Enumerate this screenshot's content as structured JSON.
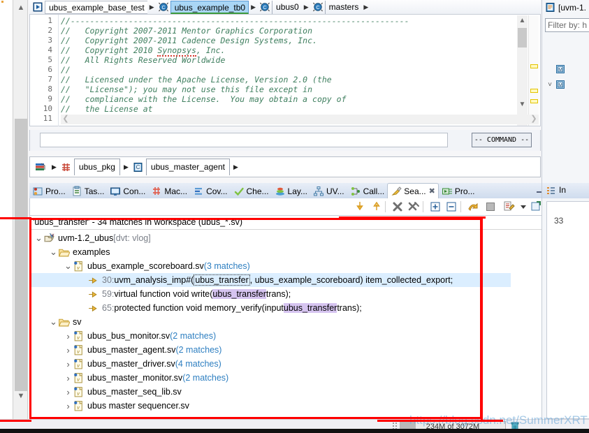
{
  "breadcrumb_top": {
    "items": [
      {
        "label": "ubus_example_base_test",
        "icon": "run-test-icon",
        "state": "normal"
      },
      {
        "label": "ubus_example_tb0",
        "icon": "uvm-component-icon",
        "state": "selected"
      },
      {
        "label": "ubus0",
        "icon": "uvm-component-icon",
        "state": "normal"
      },
      {
        "label": "masters",
        "icon": "uvm-component-icon",
        "state": "normal"
      }
    ]
  },
  "editor": {
    "lines": [
      {
        "num": "1",
        "text": "//----------------------------------------------------------------------"
      },
      {
        "num": "2",
        "text": "//   Copyright 2007-2011 Mentor Graphics Corporation"
      },
      {
        "num": "3",
        "text": "//   Copyright 2007-2011 Cadence Design Systems, Inc."
      },
      {
        "num": "4",
        "text": "//   Copyright 2010 Synopsys, Inc."
      },
      {
        "num": "5",
        "text": "//   All Rights Reserved Worldwide"
      },
      {
        "num": "6",
        "text": "//"
      },
      {
        "num": "7",
        "text": "//   Licensed under the Apache License, Version 2.0 (the"
      },
      {
        "num": "8",
        "text": "//   \"License\"); you may not use this file except in"
      },
      {
        "num": "9",
        "text": "//   compliance with the License.  You may obtain a copy of"
      },
      {
        "num": "10",
        "text": "//   the License at"
      },
      {
        "num": "11",
        "text": "//"
      }
    ],
    "misspelled_word": "Synopsys"
  },
  "command_bar": {
    "input_value": "",
    "mode_label": "-- COMMAND --"
  },
  "outline_breadcrumb": {
    "root_icon": "source-library-icon",
    "items": [
      {
        "label": "ubus_pkg",
        "icon": "package-icon"
      },
      {
        "label": "ubus_master_agent",
        "icon": "class-icon"
      }
    ]
  },
  "view_tabs": [
    {
      "label": "Pro...",
      "icon": "problems-icon",
      "active": false
    },
    {
      "label": "Tas...",
      "icon": "tasks-icon",
      "active": false
    },
    {
      "label": "Con...",
      "icon": "console-icon",
      "active": false
    },
    {
      "label": "Mac...",
      "icon": "macros-icon",
      "active": false
    },
    {
      "label": "Cov...",
      "icon": "coverage-icon",
      "active": false
    },
    {
      "label": "Che...",
      "icon": "checks-icon",
      "active": false
    },
    {
      "label": "Lay...",
      "icon": "layers-icon",
      "active": false
    },
    {
      "label": "UV...",
      "icon": "uvm-hierarchy-icon",
      "active": false
    },
    {
      "label": "Call...",
      "icon": "call-hierarchy-icon",
      "active": false
    },
    {
      "label": "Sea...",
      "icon": "search-icon",
      "active": true,
      "closable": true
    },
    {
      "label": "Pro...",
      "icon": "progress-icon",
      "active": false
    }
  ],
  "search_toolbar": [
    {
      "name": "show-next-match-icon"
    },
    {
      "name": "show-previous-match-icon"
    },
    {
      "name": "remove-selected-matches-icon"
    },
    {
      "name": "remove-all-matches-icon"
    },
    {
      "name": "expand-all-icon"
    },
    {
      "name": "collapse-all-icon"
    },
    {
      "name": "previous-search-icon"
    },
    {
      "name": "stop-search-icon"
    },
    {
      "name": "search-history-icon"
    },
    {
      "name": "search-history-dropdown-icon"
    },
    {
      "name": "pin-search-view-icon"
    },
    {
      "name": "view-menu-icon"
    }
  ],
  "search_results": {
    "header": "'ubus_transfer' - 34 matches in workspace (ubus_*.sv)",
    "query": "ubus_transfer",
    "match_count": "34",
    "scope": "workspace",
    "file_pattern": "ubus_*.sv",
    "tree": [
      {
        "depth": 0,
        "twisty": "expanded",
        "icon": "project-icon",
        "label": "uvm-1.2_ubus",
        "suffix": " [dvt: vlog]",
        "suffix_style": "muted"
      },
      {
        "depth": 1,
        "twisty": "expanded",
        "icon": "folder-icon",
        "label": "examples",
        "suffix": "",
        "suffix_style": "none"
      },
      {
        "depth": 2,
        "twisty": "expanded",
        "icon": "verilog-file-icon",
        "label": "ubus_example_scoreboard.sv",
        "suffix": " (3 matches)",
        "suffix_style": "count"
      },
      {
        "depth": 3,
        "twisty": "none",
        "icon": "match-arrow-icon",
        "selected": true,
        "line_number": "30:",
        "parts": [
          {
            "t": " uvm_analysis_imp#(",
            "h": "none"
          },
          {
            "t": "ubus_transfer",
            "h": "dotted"
          },
          {
            "t": ", ubus_example_scoreboard) item_collected_export;",
            "h": "none"
          }
        ]
      },
      {
        "depth": 3,
        "twisty": "none",
        "icon": "match-arrow-icon",
        "selected": false,
        "line_number": "59:",
        "parts": [
          {
            "t": " virtual function void write(",
            "h": "none"
          },
          {
            "t": "ubus_transfer",
            "h": "solid"
          },
          {
            "t": " trans);",
            "h": "none"
          }
        ]
      },
      {
        "depth": 3,
        "twisty": "none",
        "icon": "match-arrow-icon",
        "selected": false,
        "line_number": "65:",
        "parts": [
          {
            "t": " protected function void memory_verify(input ",
            "h": "none"
          },
          {
            "t": "ubus_transfer",
            "h": "solid"
          },
          {
            "t": " trans);",
            "h": "none"
          }
        ]
      },
      {
        "depth": 1,
        "twisty": "expanded",
        "icon": "folder-icon",
        "label": "sv",
        "suffix": "",
        "suffix_style": "none"
      },
      {
        "depth": 2,
        "twisty": "collapsed",
        "icon": "verilog-file-icon",
        "label": "ubus_bus_monitor.sv",
        "suffix": " (2 matches)",
        "suffix_style": "count"
      },
      {
        "depth": 2,
        "twisty": "collapsed",
        "icon": "verilog-file-icon",
        "label": "ubus_master_agent.sv",
        "suffix": " (2 matches)",
        "suffix_style": "count"
      },
      {
        "depth": 2,
        "twisty": "collapsed",
        "icon": "verilog-file-icon",
        "label": "ubus_master_driver.sv",
        "suffix": " (4 matches)",
        "suffix_style": "count"
      },
      {
        "depth": 2,
        "twisty": "collapsed",
        "icon": "verilog-file-icon",
        "label": "ubus_master_monitor.sv",
        "suffix": " (2 matches)",
        "suffix_style": "count"
      },
      {
        "depth": 2,
        "twisty": "collapsed",
        "icon": "verilog-file-icon",
        "label": "ubus_master_seq_lib.sv",
        "suffix": "",
        "suffix_style": "none"
      },
      {
        "depth": 2,
        "twisty": "collapsed",
        "icon": "verilog-file-icon",
        "label": "ubus master sequencer.sv",
        "suffix": "",
        "suffix_style": "none"
      }
    ]
  },
  "right_dock": {
    "title": "[uvm-1.",
    "title_icon": "uvm-view-icon",
    "filter_placeholder": "Filter by: h",
    "tree": [
      {
        "twisty": "none",
        "icon": "module-icon"
      },
      {
        "twisty": "expanded",
        "icon": "module-icon"
      }
    ],
    "section_label": "In",
    "section_icon": "list-icon",
    "body_value": "33"
  },
  "status_bar": {
    "memory": "234M of 3072M",
    "trash_icon": "trash-icon"
  },
  "watermark": "https://blog.csdn.net/SummerXRT",
  "colors": {
    "accent_blue": "#2e7fc1",
    "selection_blue": "#dbeeff",
    "match_highlight": "#d6c4f0",
    "annotation_red": "#ff0000",
    "comment_green": "#3f7f5f",
    "tab_active": "#ffffff"
  }
}
